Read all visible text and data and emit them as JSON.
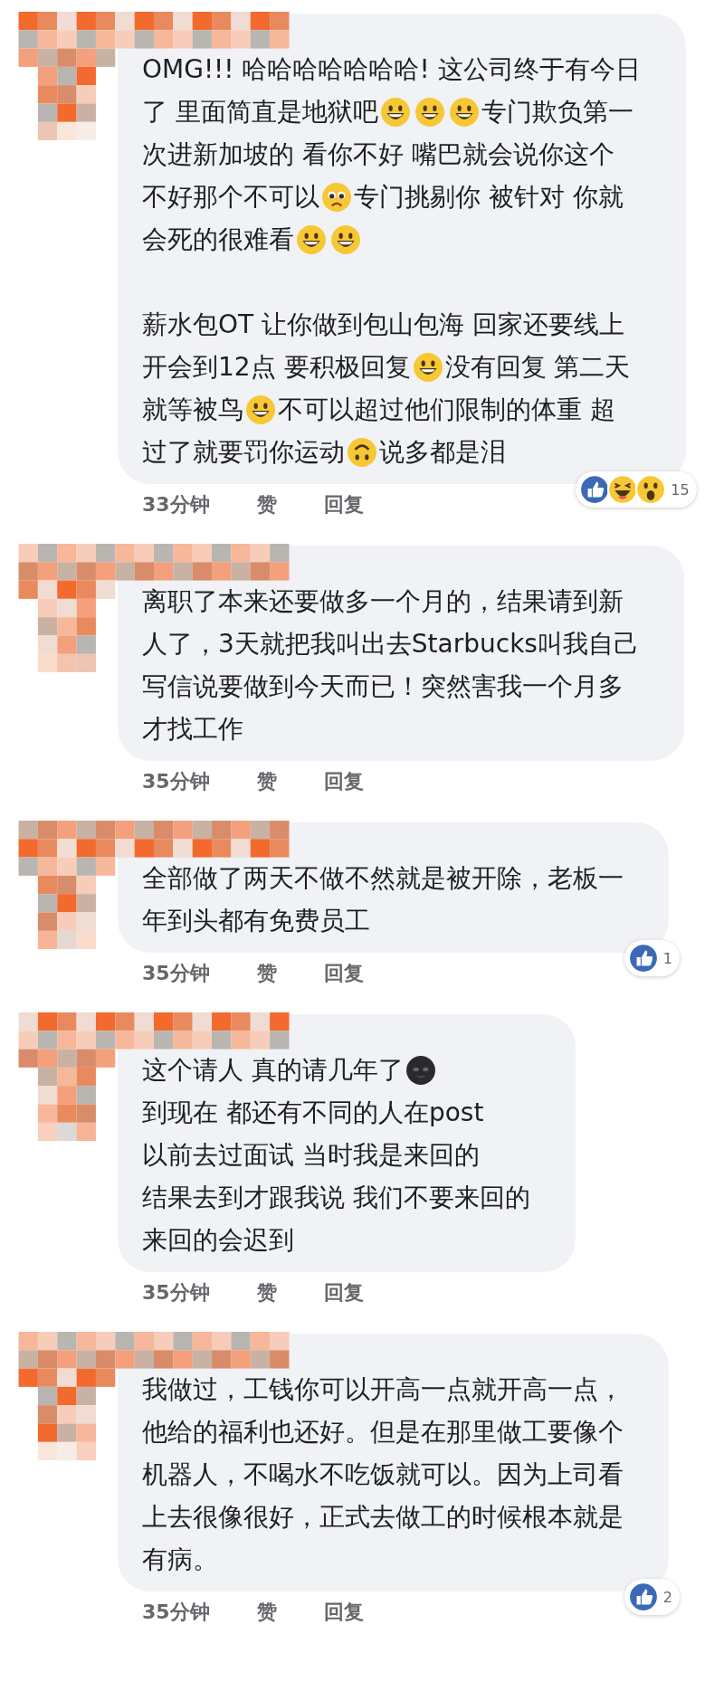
{
  "comments": [
    {
      "paragraphs": [
        [
          [
            {
              "kind": "text",
              "text": "OMG!!! 哈哈哈哈哈哈哈! 这公司终于有今日"
            }
          ],
          [
            {
              "kind": "text",
              "text": "了 里面简直是地狱吧"
            },
            {
              "kind": "grin"
            },
            {
              "kind": "grin"
            },
            {
              "kind": "grin"
            },
            {
              "kind": "text",
              "text": "专门欺负第一"
            }
          ],
          [
            {
              "kind": "text",
              "text": "次进新加坡的 看你不好 嘴巴就会说你这个"
            }
          ],
          [
            {
              "kind": "text",
              "text": "不好那个不可以"
            },
            {
              "kind": "worried"
            },
            {
              "kind": "text",
              "text": "专门挑剔你 被针对 你就"
            }
          ],
          [
            {
              "kind": "text",
              "text": "会死的很难看"
            },
            {
              "kind": "grin"
            },
            {
              "kind": "grin"
            }
          ]
        ],
        [
          [
            {
              "kind": "text",
              "text": "薪水包OT 让你做到包山包海 回家还要线上"
            }
          ],
          [
            {
              "kind": "text",
              "text": "开会到12点 要积极回复"
            },
            {
              "kind": "grin"
            },
            {
              "kind": "text",
              "text": "没有回复 第二天"
            }
          ],
          [
            {
              "kind": "text",
              "text": "就等被鸟"
            },
            {
              "kind": "grin"
            },
            {
              "kind": "text",
              "text": "不可以超过他们限制的体重 超"
            }
          ],
          [
            {
              "kind": "text",
              "text": "过了就要罚你运动"
            },
            {
              "kind": "upside"
            },
            {
              "kind": "text",
              "text": "说多都是泪"
            }
          ]
        ]
      ],
      "time": "33分钟",
      "like": "赞",
      "reply": "回复",
      "reactions": {
        "icons": [
          {
            "kind": "like"
          },
          {
            "kind": "haha"
          },
          {
            "kind": "wow"
          }
        ],
        "count": "15"
      }
    },
    {
      "paragraphs": [
        [
          [
            {
              "kind": "text",
              "text": "离职了本来还要做多一个月的，结果请到新"
            }
          ],
          [
            {
              "kind": "text",
              "text": "人了，3天就把我叫出去Starbucks叫我自己"
            }
          ],
          [
            {
              "kind": "text",
              "text": "写信说要做到今天而已！突然害我一个月多"
            }
          ],
          [
            {
              "kind": "text",
              "text": "才找工作"
            }
          ]
        ]
      ],
      "time": "35分钟",
      "like": "赞",
      "reply": "回复"
    },
    {
      "paragraphs": [
        [
          [
            {
              "kind": "text",
              "text": "全部做了两天不做不然就是被开除，老板一"
            }
          ],
          [
            {
              "kind": "text",
              "text": "年到头都有免费员工"
            }
          ]
        ]
      ],
      "time": "35分钟",
      "like": "赞",
      "reply": "回复",
      "reactions": {
        "icons": [
          {
            "kind": "like"
          }
        ],
        "count": "1"
      }
    },
    {
      "paragraphs": [
        [
          [
            {
              "kind": "text",
              "text": "这个请人 真的请几年了"
            },
            {
              "kind": "moon"
            }
          ],
          [
            {
              "kind": "text",
              "text": "到现在 都还有不同的人在post"
            }
          ],
          [
            {
              "kind": "text",
              "text": "以前去过面试 当时我是来回的"
            }
          ],
          [
            {
              "kind": "text",
              "text": "结果去到才跟我说 我们不要来回的"
            }
          ],
          [
            {
              "kind": "text",
              "text": "来回的会迟到"
            }
          ]
        ]
      ],
      "time": "35分钟",
      "like": "赞",
      "reply": "回复"
    },
    {
      "paragraphs": [
        [
          [
            {
              "kind": "text",
              "text": "我做过，工钱你可以开高一点就开高一点，"
            }
          ],
          [
            {
              "kind": "text",
              "text": "他给的福利也还好。但是在那里做工要像个"
            }
          ],
          [
            {
              "kind": "text",
              "text": "机器人，不喝水不吃饭就可以。因为上司看"
            }
          ],
          [
            {
              "kind": "text",
              "text": "上去很像很好，正式去做工的时候根本就是"
            }
          ],
          [
            {
              "kind": "text",
              "text": "有病。"
            }
          ]
        ]
      ],
      "time": "35分钟",
      "like": "赞",
      "reply": "回复",
      "reactions": {
        "icons": [
          {
            "kind": "like"
          }
        ],
        "count": "2"
      }
    }
  ]
}
